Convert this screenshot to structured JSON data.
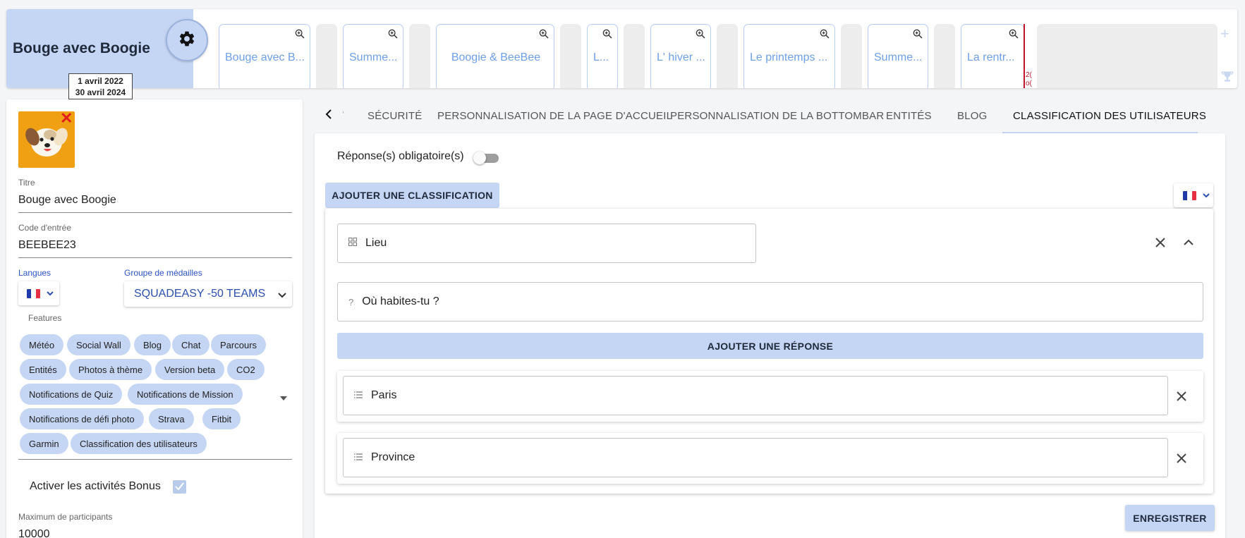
{
  "header": {
    "program_title": "Bouge avec Boogie",
    "date_start": "1 avril 2022",
    "date_end": "30 avril 2024",
    "seasons": [
      {
        "label": "Bouge avec B..."
      },
      {
        "label": "Summe..."
      },
      {
        "label": "Boogie & BeeBee"
      },
      {
        "label": "L..."
      },
      {
        "label": "L' hiver ..."
      },
      {
        "label": "Le printemps ..."
      },
      {
        "label": "Summe..."
      },
      {
        "label": "La rentr..."
      }
    ],
    "marker_text": "2(\no("
  },
  "left": {
    "title_label": "Titre",
    "title_value": "Bouge avec Boogie",
    "code_label": "Code d'entrée",
    "code_value": "BEEBEE23",
    "languages_label": "Langues",
    "medals_label": "Groupe de médailles",
    "medals_value": "SQUADEASY -50 TEAMS",
    "features_label": "Features",
    "features": [
      "Météo",
      "Social Wall",
      "Blog",
      "Chat",
      "Parcours",
      "Entités",
      "Photos à thème",
      "Version beta",
      "CO2",
      "Notifications de Quiz",
      "Notifications de Mission",
      "Notifications de défi photo",
      "Strava",
      "Fitbit",
      "Garmin",
      "Classification des utilisateurs"
    ],
    "bonus_label": "Activer les activités Bonus",
    "bonus_checked": true,
    "max_label": "Maximum de participants",
    "max_value": "10000"
  },
  "tabs": {
    "items": [
      {
        "label": "SÉCURITÉ"
      },
      {
        "label": "PERSONNALISATION DE LA PAGE D'ACCUEIL"
      },
      {
        "label": "PERSONNALISATION DE LA BOTTOMBAR"
      },
      {
        "label": "ENTITÉS"
      },
      {
        "label": "BLOG"
      },
      {
        "label": "CLASSIFICATION DES UTILISATEURS"
      }
    ],
    "active": "CLASSIFICATION DES UTILISATEURS"
  },
  "classification": {
    "required_label": "Réponse(s) obligatoire(s)",
    "required_on": false,
    "add_classification_label": "AJOUTER UNE CLASSIFICATION",
    "name_value": "Lieu",
    "question_value": "Où habites-tu ?",
    "add_answer_label": "AJOUTER UNE RÉPONSE",
    "answers": [
      {
        "value": "Paris"
      },
      {
        "value": "Province"
      }
    ],
    "save_label": "ENREGISTRER"
  },
  "colors": {
    "accent": "#c5d6f5",
    "link": "#6ea0ea",
    "marker": "#c0162c",
    "avatar_bg": "#f0a113"
  },
  "icons": [
    "gear-icon",
    "zoom-in-icon",
    "plus-icon",
    "trophy-icon",
    "close-icon",
    "chevron-up-icon",
    "chevron-down-icon",
    "chevron-left-icon",
    "grid-icon",
    "question-icon",
    "list-icon",
    "check-icon",
    "flag-fr-icon"
  ]
}
